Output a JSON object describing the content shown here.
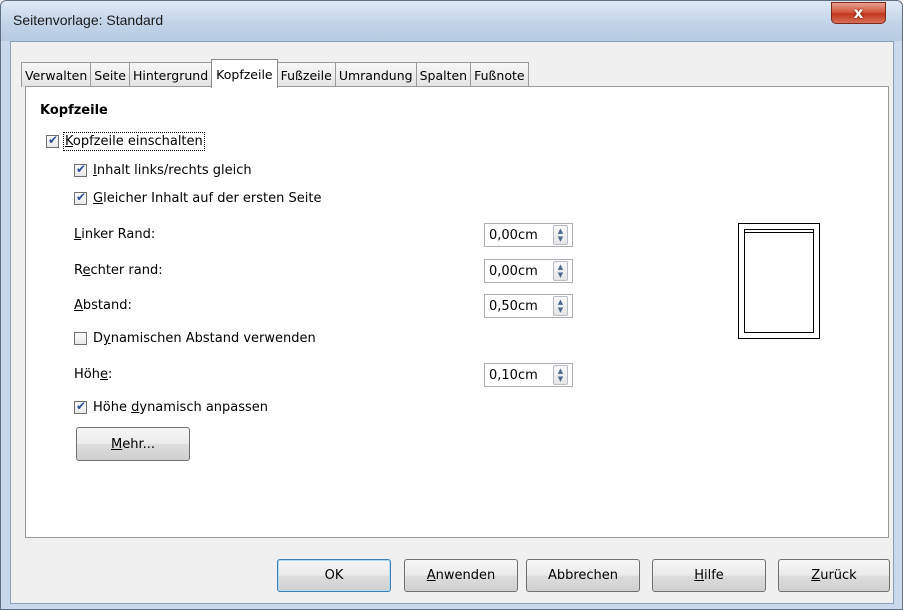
{
  "window": {
    "title": "Seitenvorlage: Standard",
    "close_glyph": "x"
  },
  "tabs": [
    {
      "label": "Verwalten"
    },
    {
      "label": "Seite"
    },
    {
      "label": "Hintergrund"
    },
    {
      "label": "Kopfzeile",
      "active": true
    },
    {
      "label": "Fußzeile"
    },
    {
      "label": "Umrandung"
    },
    {
      "label": "Spalten"
    },
    {
      "label": "Fußnote"
    }
  ],
  "header": {
    "section_title": "Kopfzeile",
    "enable": {
      "label_accel": "K",
      "label_rest": "opfzeile einschalten",
      "checked": true
    },
    "same_lr": {
      "label_accel": "I",
      "label_rest": "nhalt links/rechts gleich",
      "checked": true
    },
    "same_first": {
      "label_accel": "G",
      "label_rest": "leicher Inhalt auf der ersten Seite",
      "checked": true
    },
    "left_margin": {
      "label_accel": "L",
      "label_rest": "inker Rand:",
      "value": "0,00cm"
    },
    "right_margin": {
      "label_pre": "R",
      "label_accel": "e",
      "label_rest": "chter rand:",
      "value": "0,00cm"
    },
    "spacing": {
      "label_accel": "A",
      "label_rest": "bstand:",
      "value": "0,50cm"
    },
    "dynamic_spacing": {
      "label_pre": "D",
      "label_accel": "y",
      "label_rest": "namischen Abstand verwenden",
      "checked": false
    },
    "height": {
      "label_pre": "Höh",
      "label_accel": "e",
      "label_rest": ":",
      "value": "0,10cm"
    },
    "autofit": {
      "label_pre": "Höhe ",
      "label_accel": "d",
      "label_rest": "ynamisch anpassen",
      "checked": true
    },
    "more_button": {
      "label_accel": "M",
      "label_rest": "ehr..."
    }
  },
  "footer_buttons": {
    "ok": "OK",
    "apply": {
      "label_accel": "A",
      "label_rest": "nwenden"
    },
    "cancel": "Abbrechen",
    "help": {
      "label_accel": "H",
      "label_rest": "ilfe"
    },
    "reset": {
      "label_accel": "Z",
      "label_rest": "urück"
    }
  },
  "icons": {
    "spin_up": "▲",
    "spin_down": "▼",
    "check": "check-icon"
  }
}
